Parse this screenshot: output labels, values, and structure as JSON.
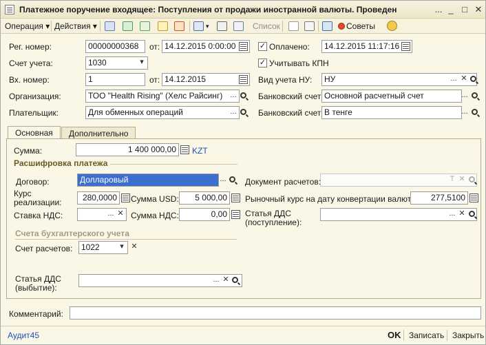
{
  "window": {
    "title": "Платежное поручение входящее: Поступления от продажи иностранной валюты. Проведен",
    "dots_label": "...",
    "minimize_label": "_",
    "maximize_label": "□",
    "close_label": "✕"
  },
  "toolbar": {
    "operation_label": "Операция",
    "actions_label": "Действия",
    "list_label": "Список",
    "advice_label": "Советы",
    "dropdown_arrow": "▾"
  },
  "header": {
    "reg_number_label": "Рег. номер:",
    "reg_number": "00000000368",
    "from_label": "от:",
    "reg_date": "14.12.2015  0:00:00",
    "paid_label": "Оплачено:",
    "paid_checked": "✓",
    "paid_date": "14.12.2015 11:17:16",
    "account_label": "Счет учета:",
    "account": "1030",
    "kpn_label": "Учитывать КПН",
    "kpn_checked": "✓",
    "in_number_label": "Вх. номер:",
    "in_number": "1",
    "in_from_label": "от:",
    "in_date": "14.12.2015",
    "nu_type_label": "Вид учета НУ:",
    "nu_type": "НУ",
    "org_label": "Организация:",
    "org": "ТОО \"Health Rising\" (Хелс Райсинг)",
    "bank_account_label": "Банковский счет:",
    "bank_account": "Основной расчетный счет",
    "payer_label": "Плательщик:",
    "payer": "Для обменных операций",
    "bank_account2_label": "Банковский счет:",
    "bank_account2": "В тенге"
  },
  "tabs": {
    "main": "Основная",
    "extra": "Дополнительно"
  },
  "main": {
    "sum_label": "Сумма:",
    "sum": "1 400 000,00",
    "currency": "KZT",
    "decode_title": "Расшифровка платежа",
    "contract_label": "Договор:",
    "contract": "Долларовый",
    "settlement_doc_label": "Документ расчетов:",
    "settlement_doc_t": "T",
    "rate_label_1": "Курс",
    "rate_label_2": "реализации:",
    "rate": "280,0000",
    "sum_usd_label": "Сумма USD:",
    "sum_usd": "5 000,00",
    "market_rate_label": "Рыночный курс на дату конвертации валюты:",
    "market_rate": "277,5100",
    "vat_rate_label": "Ставка НДС:",
    "vat_sum_label": "Сумма НДС:",
    "vat_sum": "0,00",
    "dds_in_label_1": "Статья ДДС",
    "dds_in_label_2": "(поступление):",
    "accounts_title": "Счета бухгалтерского учета",
    "settle_account_label": "Счет расчетов:",
    "settle_account": "1022",
    "dds_out_label_1": "Статья ДДС",
    "dds_out_label_2": "(выбытие):"
  },
  "footer": {
    "comment_label": "Комментарий:",
    "audit_label": "Аудит45",
    "ok_label": "OK",
    "save_label": "Записать",
    "close_label": "Закрыть"
  },
  "buttons": {
    "dots": "...",
    "clear": "✕",
    "dropdown": "▾"
  },
  "colors": {
    "background": "#fbf7e6",
    "accent": "#3a6fd0",
    "section": "#6b5a22",
    "link": "#1d4fb5"
  }
}
